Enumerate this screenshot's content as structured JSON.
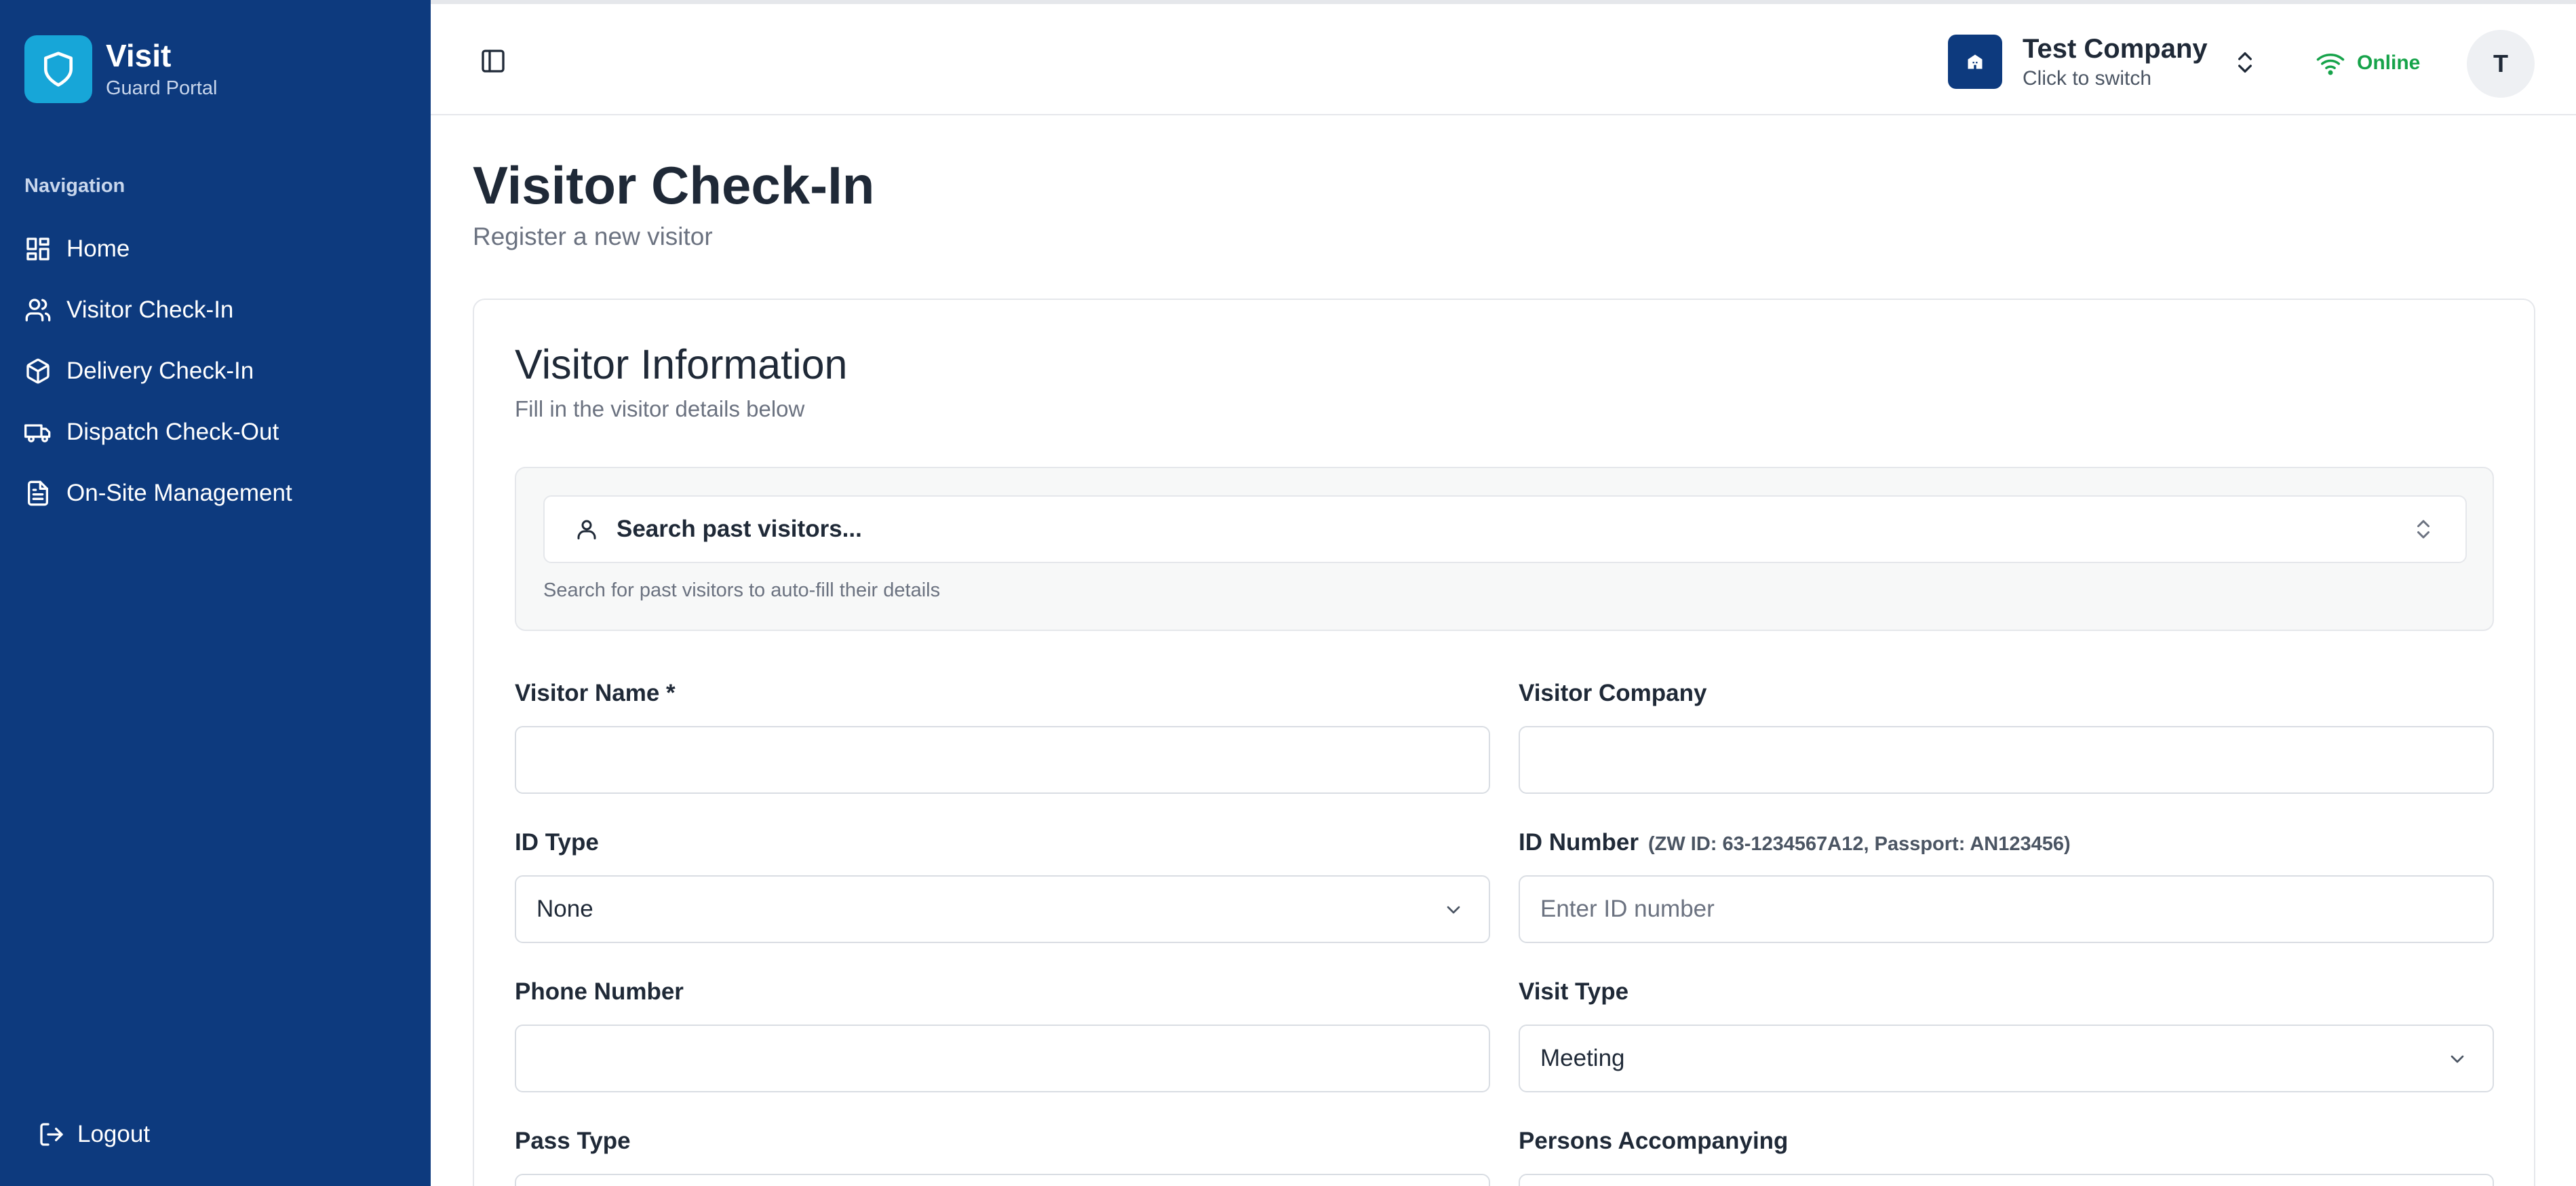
{
  "brand": {
    "name": "Visit",
    "subtitle": "Guard Portal"
  },
  "nav": {
    "heading": "Navigation",
    "items": [
      {
        "label": "Home",
        "icon": "grid-icon"
      },
      {
        "label": "Visitor Check-In",
        "icon": "users-icon"
      },
      {
        "label": "Delivery Check-In",
        "icon": "package-icon"
      },
      {
        "label": "Dispatch Check-Out",
        "icon": "truck-icon"
      },
      {
        "label": "On-Site Management",
        "icon": "file-text-icon"
      }
    ],
    "logout": "Logout"
  },
  "topbar": {
    "company": {
      "name": "Test Company",
      "sub": "Click to switch"
    },
    "status": "Online",
    "avatar_initial": "T"
  },
  "page": {
    "title": "Visitor Check-In",
    "subtitle": "Register a new visitor"
  },
  "card": {
    "title": "Visitor Information",
    "subtitle": "Fill in the visitor details below",
    "search": {
      "label": "Search past visitors...",
      "help": "Search for past visitors to auto-fill their details"
    },
    "fields": {
      "visitor_name": {
        "label": "Visitor Name *",
        "value": ""
      },
      "visitor_company": {
        "label": "Visitor Company",
        "value": ""
      },
      "id_type": {
        "label": "ID Type",
        "value": "None"
      },
      "id_number": {
        "label": "ID Number",
        "hint": "(ZW ID: 63-1234567A12, Passport: AN123456)",
        "placeholder": "Enter ID number",
        "value": ""
      },
      "phone": {
        "label": "Phone Number",
        "value": ""
      },
      "visit_type": {
        "label": "Visit Type",
        "value": "Meeting"
      },
      "pass_type": {
        "label": "Pass Type"
      },
      "persons_accompanying": {
        "label": "Persons Accompanying"
      }
    }
  },
  "colors": {
    "sidebar": "#0d3a7e",
    "logo": "#17a6d8",
    "online": "#16a34a"
  }
}
